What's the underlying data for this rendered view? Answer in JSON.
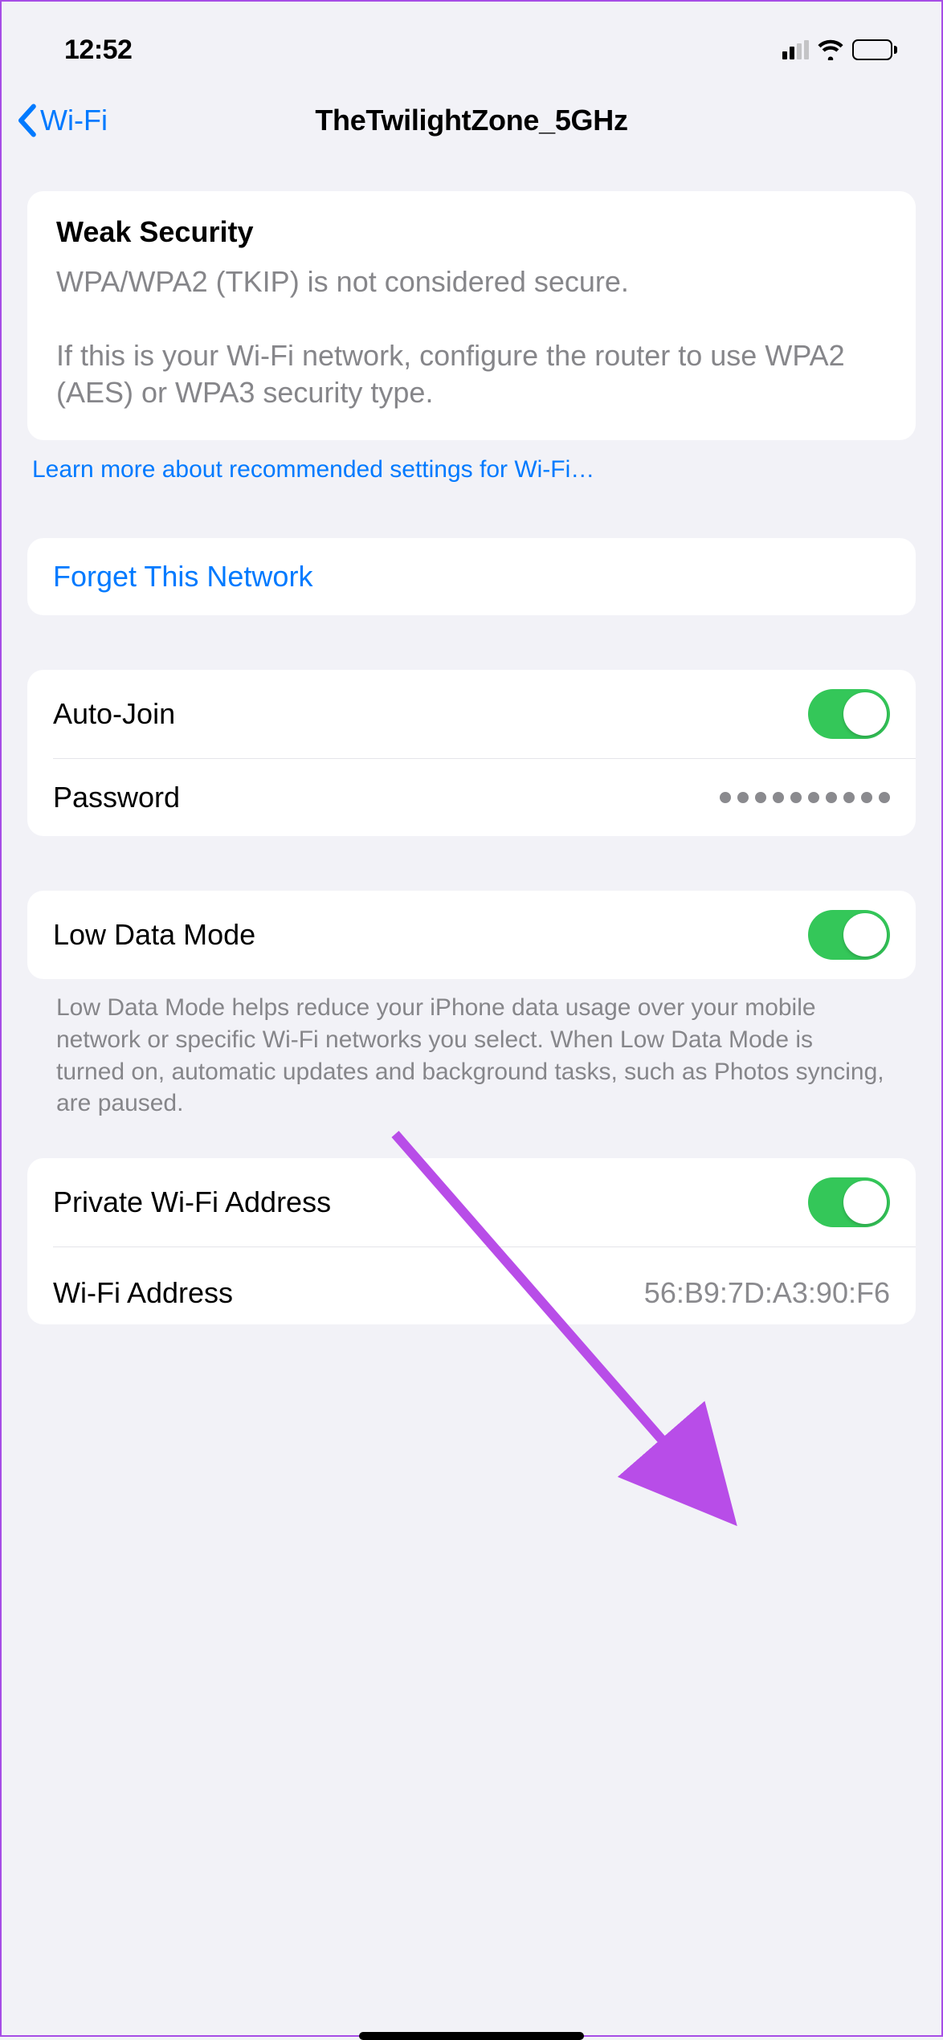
{
  "statusBar": {
    "time": "12:52"
  },
  "nav": {
    "back": "Wi-Fi",
    "title": "TheTwilightZone_5GHz"
  },
  "security": {
    "heading": "Weak Security",
    "body": "WPA/WPA2 (TKIP) is not considered secure.\n\nIf this is your Wi-Fi network, configure the router to use WPA2 (AES) or WPA3 security type."
  },
  "learnMore": "Learn more about recommended settings for Wi-Fi…",
  "forget": "Forget This Network",
  "rows": {
    "autoJoin": {
      "label": "Auto-Join",
      "on": true
    },
    "password": {
      "label": "Password",
      "value": "••••••••••"
    },
    "lowData": {
      "label": "Low Data Mode",
      "on": true
    },
    "privateAddr": {
      "label": "Private Wi-Fi Address",
      "on": true
    },
    "wifiAddr": {
      "label": "Wi-Fi Address",
      "value": "56:B9:7D:A3:90:F6"
    }
  },
  "lowDataNote": "Low Data Mode helps reduce your iPhone data usage over your mobile network or specific Wi-Fi networks you select. When Low Data Mode is turned on, automatic updates and background tasks, such as Photos syncing, are paused."
}
